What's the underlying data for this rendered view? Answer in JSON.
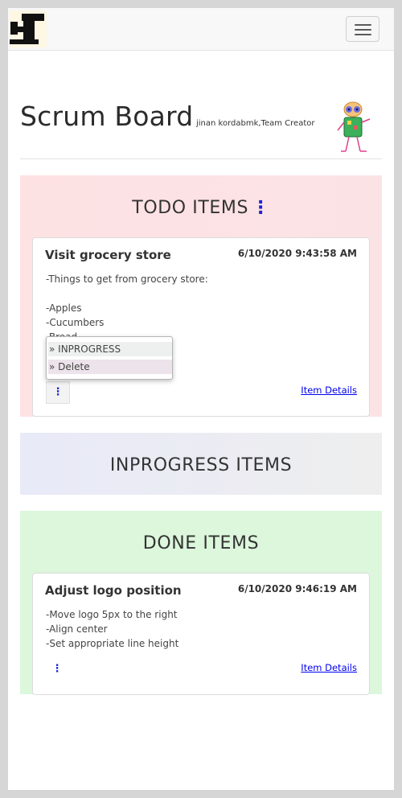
{
  "header": {
    "title": "Scrum Board",
    "subtitle": "jinan kordabmk,Team Creator"
  },
  "sections": {
    "todo": {
      "title": "TODO ITEMS",
      "menu_icon": "⋮",
      "cards": [
        {
          "name": "Visit grocery store",
          "date": "6/10/2020 9:43:58 AM",
          "lines": [
            "-Things to get from grocery store:",
            "",
            "-Apples",
            "-Cucumbers",
            "-Bread"
          ],
          "menu_icon": "⋮",
          "details_link": "Item Details",
          "dropdown": [
            "» INPROGRESS",
            "» Delete"
          ]
        }
      ]
    },
    "inprogress": {
      "title": "INPROGRESS ITEMS"
    },
    "done": {
      "title": "DONE ITEMS",
      "cards": [
        {
          "name": "Adjust logo position",
          "date": "6/10/2020 9:46:19 AM",
          "lines": [
            "-Move logo 5px to the right",
            "-Align center",
            "-Set appropriate line height"
          ],
          "menu_icon": "⋮",
          "details_link": "Item Details"
        }
      ]
    }
  },
  "colors": {
    "todo_bg": "#fde2e4",
    "inprogress_bg": "#eceef6",
    "done_bg": "#dcf7dc",
    "accent": "#1a20d8"
  }
}
